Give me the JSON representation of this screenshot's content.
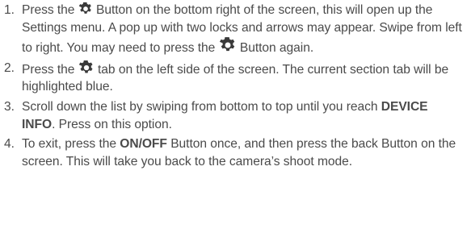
{
  "steps": [
    {
      "number": "1.",
      "t1": "Press the",
      "icon": "gear-icon",
      "t2": "Button on the bottom right of the screen, this will open up the Settings menu. A pop up with two locks and arrows may appear. Swipe from left to right. You may need to press the",
      "icon2": "gear-icon",
      "t3": "Button again."
    },
    {
      "number": "2.",
      "t1": "Press the",
      "icon": "gear-icon",
      "t2": "tab on the left side of the screen. The current section tab will be highlighted blue."
    },
    {
      "number": "3.",
      "t1": "Scroll down the list  by swiping from bottom to top until you reach",
      "bold1": "DEVICE INFO",
      "t2": ". Press on this option."
    },
    {
      "number": "4.",
      "t1": "To exit, press the",
      "bold1": "ON/OFF",
      "t2": "Button once, and then press the back Button on the screen. This will take you back to the camera’s shoot mode."
    }
  ],
  "colors": {
    "text": "#4a4a4a",
    "icon": "#3a3a3a"
  }
}
